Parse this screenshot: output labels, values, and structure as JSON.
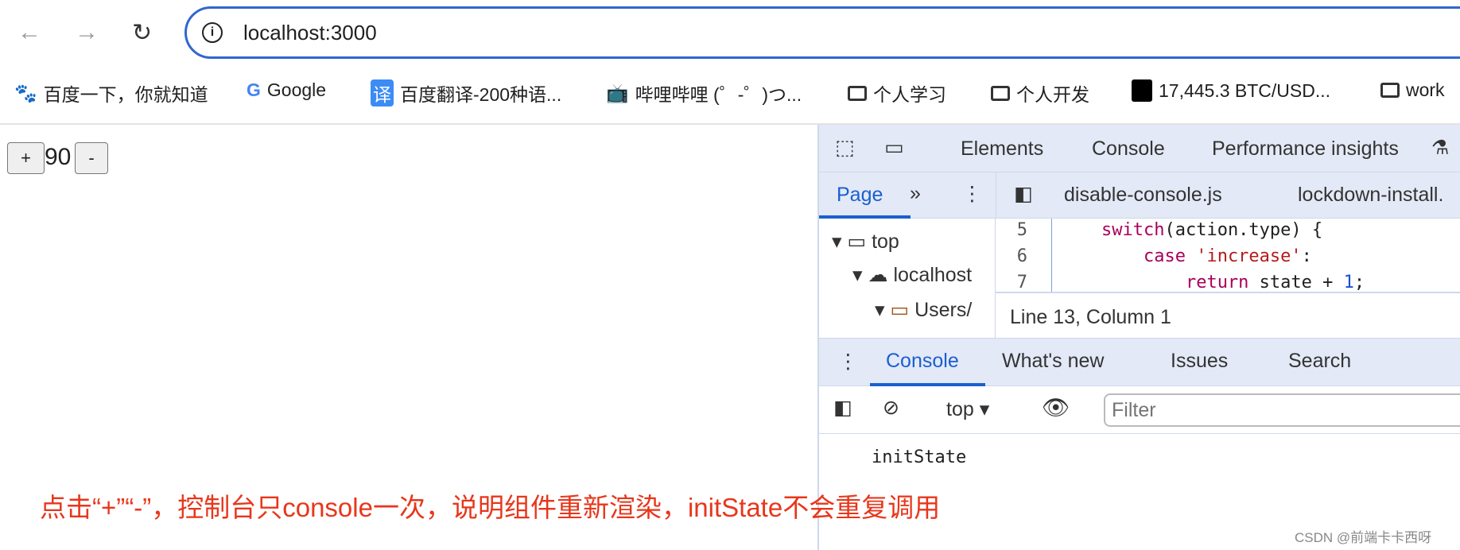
{
  "browser": {
    "url": "localhost:3000",
    "bookmarks": [
      {
        "label": "百度一下，你就知道",
        "icon": "baidu-icon"
      },
      {
        "label": "Google",
        "icon": "google-icon"
      },
      {
        "label": "百度翻译-200种语...",
        "icon": "translate-icon"
      },
      {
        "label": "哔哩哔哩 (゜-゜)つ...",
        "icon": "bilibili-icon"
      },
      {
        "label": "个人学习",
        "icon": "folder-icon"
      },
      {
        "label": "个人开发",
        "icon": "folder-icon"
      },
      {
        "label": "17,445.3 BTC/USD...",
        "icon": "btc-icon"
      },
      {
        "label": "work",
        "icon": "folder-icon"
      }
    ]
  },
  "page": {
    "plus": "+",
    "count": "90",
    "minus": "-"
  },
  "devtools": {
    "tabs": [
      "Elements",
      "Console",
      "Performance insights"
    ],
    "sources": {
      "nav_tab": "Page",
      "more": "»",
      "files": [
        "disable-console.js",
        "lockdown-install."
      ],
      "tree": [
        "top",
        "localhost",
        "Users/"
      ],
      "code": [
        {
          "n": "5",
          "indent": "    ",
          "kw": "switch",
          "rest": "(action.type) {"
        },
        {
          "n": "6",
          "indent": "        ",
          "kw": "case",
          "str": "'increase'",
          "rest": ":"
        },
        {
          "n": "7",
          "indent": "            ",
          "kw": "return",
          "rest": " state + ",
          "num": "1",
          "end": ";"
        }
      ],
      "status": "Line 13, Column 1"
    },
    "drawer": {
      "tabs": [
        "Console",
        "What's new",
        "Issues",
        "Search"
      ],
      "context": "top",
      "filter_placeholder": "Filter",
      "messages": [
        "initState"
      ]
    }
  },
  "annotation": "点击“+”“-”，控制台只console一次，说明组件重新渲染，initState不会重复调用",
  "watermark": "CSDN @前端卡卡西呀",
  "colors": {
    "accent": "#1a5fd0",
    "annotation": "#e8361b"
  }
}
